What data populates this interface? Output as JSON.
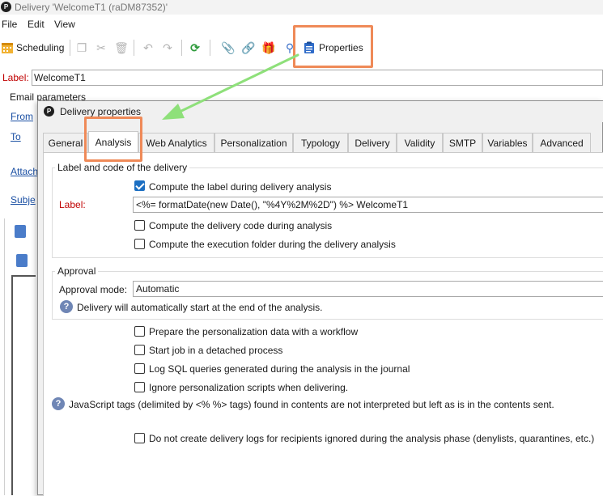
{
  "window": {
    "title": "Delivery 'WelcomeT1 (raDM87352)'",
    "app_icon": "P"
  },
  "menu": [
    "File",
    "Edit",
    "View"
  ],
  "toolbar": {
    "scheduling_label": "Scheduling",
    "properties_label": "Properties",
    "icons": [
      "calendar-icon",
      "copy-icon",
      "cut-icon",
      "delete-icon",
      "undo-icon",
      "redo-icon",
      "refresh-icon",
      "attachment-icon",
      "link-icon",
      "gift-icon",
      "tracking-icon",
      "clipboard-icon"
    ]
  },
  "outer_form": {
    "label_caption": "Label:",
    "label_value": "WelcomeT1",
    "email_params": "Email parameters",
    "links": [
      "From",
      "To",
      "Attach",
      "Subje"
    ]
  },
  "dialog": {
    "title": "Delivery properties",
    "tabs": [
      "General",
      "Analysis",
      "Web Analytics",
      "Personalization",
      "Typology",
      "Delivery",
      "Validity",
      "SMTP",
      "Variables",
      "Advanced"
    ],
    "active_tab": "Analysis",
    "label_group": {
      "legend": "Label and code of the delivery",
      "compute_label": "Compute the label during delivery analysis",
      "compute_label_checked": true,
      "label_caption": "Label:",
      "label_value": "<%= formatDate(new Date(), \"%4Y%2M%2D\") %> WelcomeT1",
      "compute_code": "Compute the delivery code during analysis",
      "compute_folder": "Compute the execution folder during the delivery analysis"
    },
    "approval_group": {
      "legend": "Approval",
      "mode_caption": "Approval mode:",
      "mode_value": "Automatic",
      "info": "Delivery will automatically start at the end of the analysis."
    },
    "options": [
      "Prepare the personalization data with a workflow",
      "Start job in a detached process",
      "Log SQL queries generated during the analysis in the journal",
      "Ignore personalization scripts when delivering."
    ],
    "js_info": "JavaScript tags (delimited by <% %> tags) found in contents are not interpreted but left as is in the contents sent.",
    "denylist_option": "Do not create delivery logs for recipients ignored during the analysis phase (denylists, quarantines, etc.)"
  },
  "colors": {
    "callout": "#ef8a58",
    "arrow": "#8ee07a",
    "required_label": "#c00000",
    "checkbox_checked": "#1c6fc2"
  }
}
